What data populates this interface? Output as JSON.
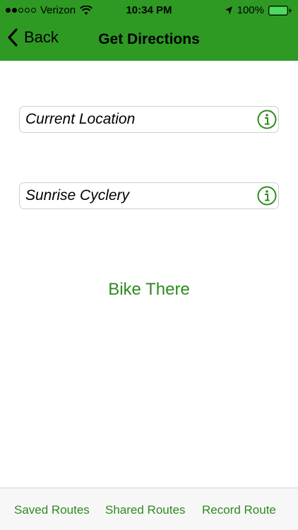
{
  "status_bar": {
    "carrier": "Verizon",
    "time": "10:34 PM",
    "battery": "100%"
  },
  "nav": {
    "back_label": "Back",
    "title": "Get Directions"
  },
  "fields": {
    "start_value": "Current Location",
    "destination_value": "Sunrise Cyclery"
  },
  "actions": {
    "bike_there_label": "Bike There"
  },
  "tab_bar": {
    "saved_routes": "Saved Routes",
    "shared_routes": "Shared Routes",
    "record_route": "Record Route"
  },
  "colors": {
    "accent_green": "#2e9a24",
    "link_green": "#2e8b1f",
    "battery_green": "#4cd964"
  }
}
